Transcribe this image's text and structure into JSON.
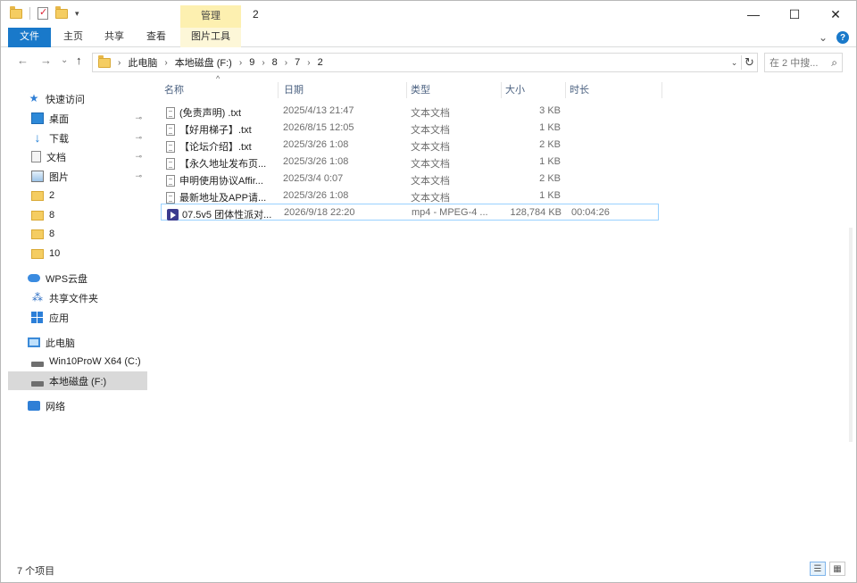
{
  "window": {
    "title": "2",
    "contextual_tab_header": "管理",
    "controls": {
      "minimize": "—",
      "maximize": "☐",
      "close": "✕"
    }
  },
  "ribbon": {
    "tabs": [
      {
        "label": "文件"
      },
      {
        "label": "主页"
      },
      {
        "label": "共享"
      },
      {
        "label": "查看"
      },
      {
        "label": "图片工具"
      }
    ],
    "collapse": "⌄",
    "help": "?"
  },
  "nav": {
    "back": "←",
    "forward": "→",
    "recent": "⌄",
    "up": "↑"
  },
  "address": {
    "crumbs": [
      "此电脑",
      "本地磁盘 (F:)",
      "9",
      "8",
      "7",
      "2"
    ],
    "separator": "›",
    "refresh": "↻",
    "dropdown": "⌄"
  },
  "search": {
    "placeholder": "在 2 中搜...",
    "icon": "search-icon",
    "glyph": "⌕"
  },
  "sidebar": {
    "quick_access": "快速访问",
    "items": [
      {
        "label": "桌面",
        "pinned": true
      },
      {
        "label": "下载",
        "pinned": true
      },
      {
        "label": "文档",
        "pinned": true
      },
      {
        "label": "图片",
        "pinned": true
      },
      {
        "label": "2"
      },
      {
        "label": "8"
      },
      {
        "label": "8"
      },
      {
        "label": "10"
      }
    ],
    "wps": "WPS云盘",
    "shared_folder": "共享文件夹",
    "apps": "应用",
    "this_pc": "此电脑",
    "drives": [
      {
        "label": "Win10ProW X64 (C:)"
      },
      {
        "label": "本地磁盘 (F:)"
      }
    ],
    "network": "网络",
    "pin_glyph": "📌"
  },
  "columns": {
    "name": "名称",
    "date": "日期",
    "type": "类型",
    "size": "大小",
    "duration": "时长",
    "sort_arrow": "^"
  },
  "files": [
    {
      "name": "(免责声明) .txt",
      "date": "2025/4/13 21:47",
      "type": "文本文档",
      "size": "3 KB",
      "duration": "",
      "kind": "txt"
    },
    {
      "name": "【好用梯子】.txt",
      "date": "2026/8/15 12:05",
      "type": "文本文档",
      "size": "1 KB",
      "duration": "",
      "kind": "txt"
    },
    {
      "name": "【论坛介绍】.txt",
      "date": "2025/3/26 1:08",
      "type": "文本文档",
      "size": "2 KB",
      "duration": "",
      "kind": "txt"
    },
    {
      "name": "【永久地址发布页...",
      "date": "2025/3/26 1:08",
      "type": "文本文档",
      "size": "1 KB",
      "duration": "",
      "kind": "txt"
    },
    {
      "name": "申明使用协议Affir...",
      "date": "2025/3/4 0:07",
      "type": "文本文档",
      "size": "2 KB",
      "duration": "",
      "kind": "txt"
    },
    {
      "name": "最新地址及APP请...",
      "date": "2025/3/26 1:08",
      "type": "文本文档",
      "size": "1 KB",
      "duration": "",
      "kind": "txt"
    },
    {
      "name": "07.5v5 团体性派对...",
      "date": "2026/9/18 22:20",
      "type": "mp4 - MPEG-4 ...",
      "size": "128,784 KB",
      "duration": "00:04:26",
      "kind": "video"
    }
  ],
  "status": {
    "item_count": "7 个项目"
  }
}
